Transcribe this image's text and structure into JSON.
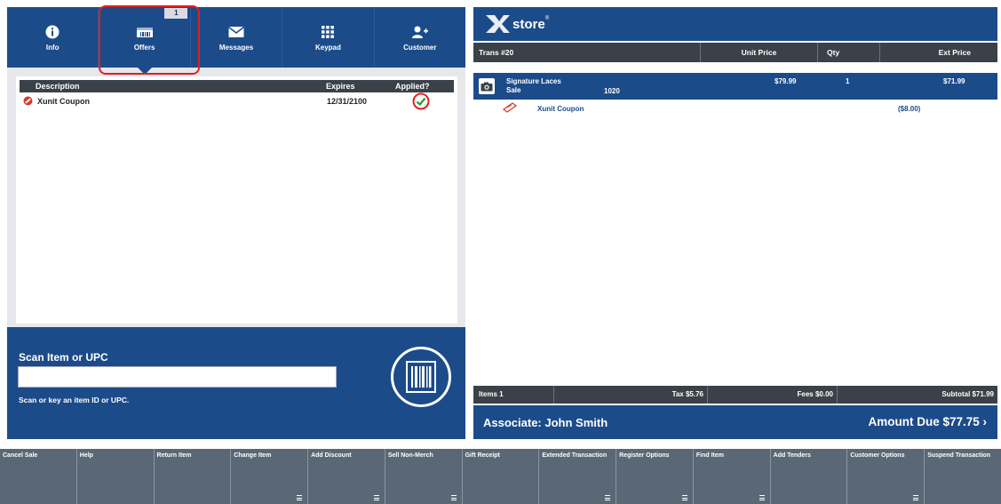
{
  "tabs": [
    {
      "label": "Info",
      "icon": "info-icon"
    },
    {
      "label": "Offers",
      "icon": "offers-icon",
      "badge": "1",
      "active": true
    },
    {
      "label": "Messages",
      "icon": "envelope-icon"
    },
    {
      "label": "Keypad",
      "icon": "keypad-icon"
    },
    {
      "label": "Customer",
      "icon": "add-customer-icon"
    }
  ],
  "offers": {
    "headers": {
      "description": "Description",
      "expires": "Expires",
      "applied": "Applied?"
    },
    "rows": [
      {
        "description": "Xunit Coupon",
        "expires": "12/31/2100",
        "applied": true
      }
    ]
  },
  "scan": {
    "title": "Scan Item or UPC",
    "value": "",
    "help": "Scan or key an item ID or UPC."
  },
  "brand": {
    "logo_text": "store",
    "logo_sup": "®"
  },
  "transaction": {
    "headers": {
      "trans": "Trans #20",
      "unit_price": "Unit Price",
      "qty": "Qty",
      "ext_price": "Ext Price"
    },
    "items": [
      {
        "name": "Signature Laces",
        "type": "Sale",
        "code": "1020",
        "unit_price": "$79.99",
        "qty": "1",
        "ext_price": "$71.99"
      }
    ],
    "discounts": [
      {
        "name": "Xunit Coupon",
        "amount": "($8.00)"
      }
    ],
    "totals": {
      "items": "Items 1",
      "tax": "Tax $5.76",
      "fees": "Fees $0.00",
      "subtotal": "Subtotal $71.99"
    },
    "associate": "Associate: John Smith",
    "amount_due": "Amount Due  $77.75  ›"
  },
  "function_keys": [
    {
      "label": "Cancel Sale",
      "menu": false
    },
    {
      "label": "Help",
      "menu": false
    },
    {
      "label": "Return Item",
      "menu": false
    },
    {
      "label": "Change Item",
      "menu": true
    },
    {
      "label": "Add Discount",
      "menu": true
    },
    {
      "label": "Sell Non-Merch",
      "menu": true
    },
    {
      "label": "Gift Receipt",
      "menu": false
    },
    {
      "label": "Extended Transaction",
      "menu": true
    },
    {
      "label": "Register Options",
      "menu": true
    },
    {
      "label": "Find Item",
      "menu": true
    },
    {
      "label": "Add Tenders",
      "menu": false
    },
    {
      "label": "Customer Options",
      "menu": true
    },
    {
      "label": "Suspend Transaction",
      "menu": false
    }
  ],
  "colors": {
    "primary": "#1c4b8a",
    "header_dark": "#3a4149",
    "fkey_bg": "#5a6876",
    "highlight_red": "#e02020"
  }
}
